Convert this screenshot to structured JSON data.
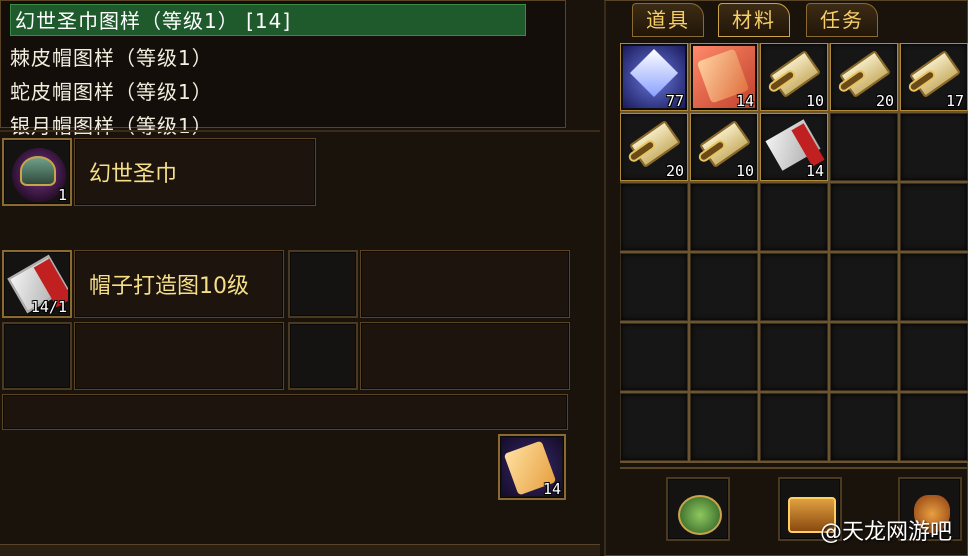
{
  "recipe_list": {
    "rows": [
      {
        "label": "幻世圣巾图样（等级1） [14]",
        "selected": true
      },
      {
        "label": "棘皮帽图样（等级1）",
        "selected": false
      },
      {
        "label": "蛇皮帽图样（等级1）",
        "selected": false
      },
      {
        "label": "银月帽图样（等级1）",
        "selected": false
      }
    ],
    "scroll_down_glyph": "⌄"
  },
  "product": {
    "name": "幻世圣巾",
    "count": "1",
    "icon": "helmet-icon"
  },
  "material": {
    "name": "帽子打造图10级",
    "count": "14/1",
    "icon": "scroll-icon"
  },
  "output_item": {
    "count": "14",
    "icon": "silk-icon"
  },
  "inventory": {
    "tabs": [
      "道具",
      "材料",
      "任务"
    ],
    "active_tab_index": 1,
    "items": [
      {
        "icon": "crystal-icon",
        "count": "77"
      },
      {
        "icon": "silk-icon",
        "count": "14"
      },
      {
        "icon": "scroll-icon",
        "count": "10"
      },
      {
        "icon": "scroll-icon",
        "count": "20"
      },
      {
        "icon": "scroll-icon",
        "count": "17"
      },
      {
        "icon": "scroll-icon",
        "count": "20"
      },
      {
        "icon": "scroll-icon",
        "count": "10"
      },
      {
        "icon": "scroll-red-icon",
        "count": "14"
      }
    ],
    "bottom_items": [
      {
        "icon": "pouch-icon"
      },
      {
        "icon": "treasure-chest-icon"
      },
      {
        "icon": "money-bag-icon"
      }
    ]
  },
  "watermark": "@天龙网游吧",
  "colors": {
    "accent_gold": "#f6cf6a",
    "selection_green": "#1f5a2c",
    "frame_brown": "#5a4426"
  }
}
